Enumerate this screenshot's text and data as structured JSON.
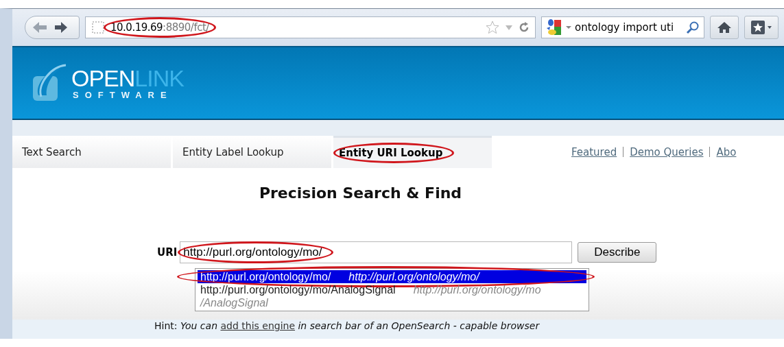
{
  "browser": {
    "url_host": "10.0.19.69",
    "url_rest": ":8890/fct/",
    "url_circled": true,
    "search_query": "ontology import uti"
  },
  "logo": {
    "name_main": "OPEN",
    "name_accent": "LINK",
    "tagline": "SOFTWARE"
  },
  "tabs": [
    {
      "label": "Text Search",
      "selected": false,
      "circled": false
    },
    {
      "label": "Entity Label Lookup",
      "selected": false,
      "circled": false
    },
    {
      "label": "Entity URI Lookup",
      "selected": true,
      "circled": true
    }
  ],
  "links": [
    "Featured",
    "Demo Queries",
    "Abo"
  ],
  "heading": "Precision Search & Find",
  "form": {
    "label": "URI",
    "value": "http://purl.org/ontology/mo/",
    "value_circled": true,
    "button": "Describe"
  },
  "suggestions": [
    {
      "uri": "http://purl.org/ontology/mo/",
      "label": "http://purl.org/ontology/mo/",
      "selected": true,
      "circled": true
    },
    {
      "uri": "http://purl.org/ontology/mo/AnalogSignal",
      "label": "http://purl.org/ontology/mo/AnalogSignal",
      "selected": false,
      "circled": false
    }
  ],
  "hint": {
    "text": "Hint: *You can* ",
    "link": "add this engine",
    "text_after": " *in search bar of an OpenSearch - capable browser*"
  }
}
